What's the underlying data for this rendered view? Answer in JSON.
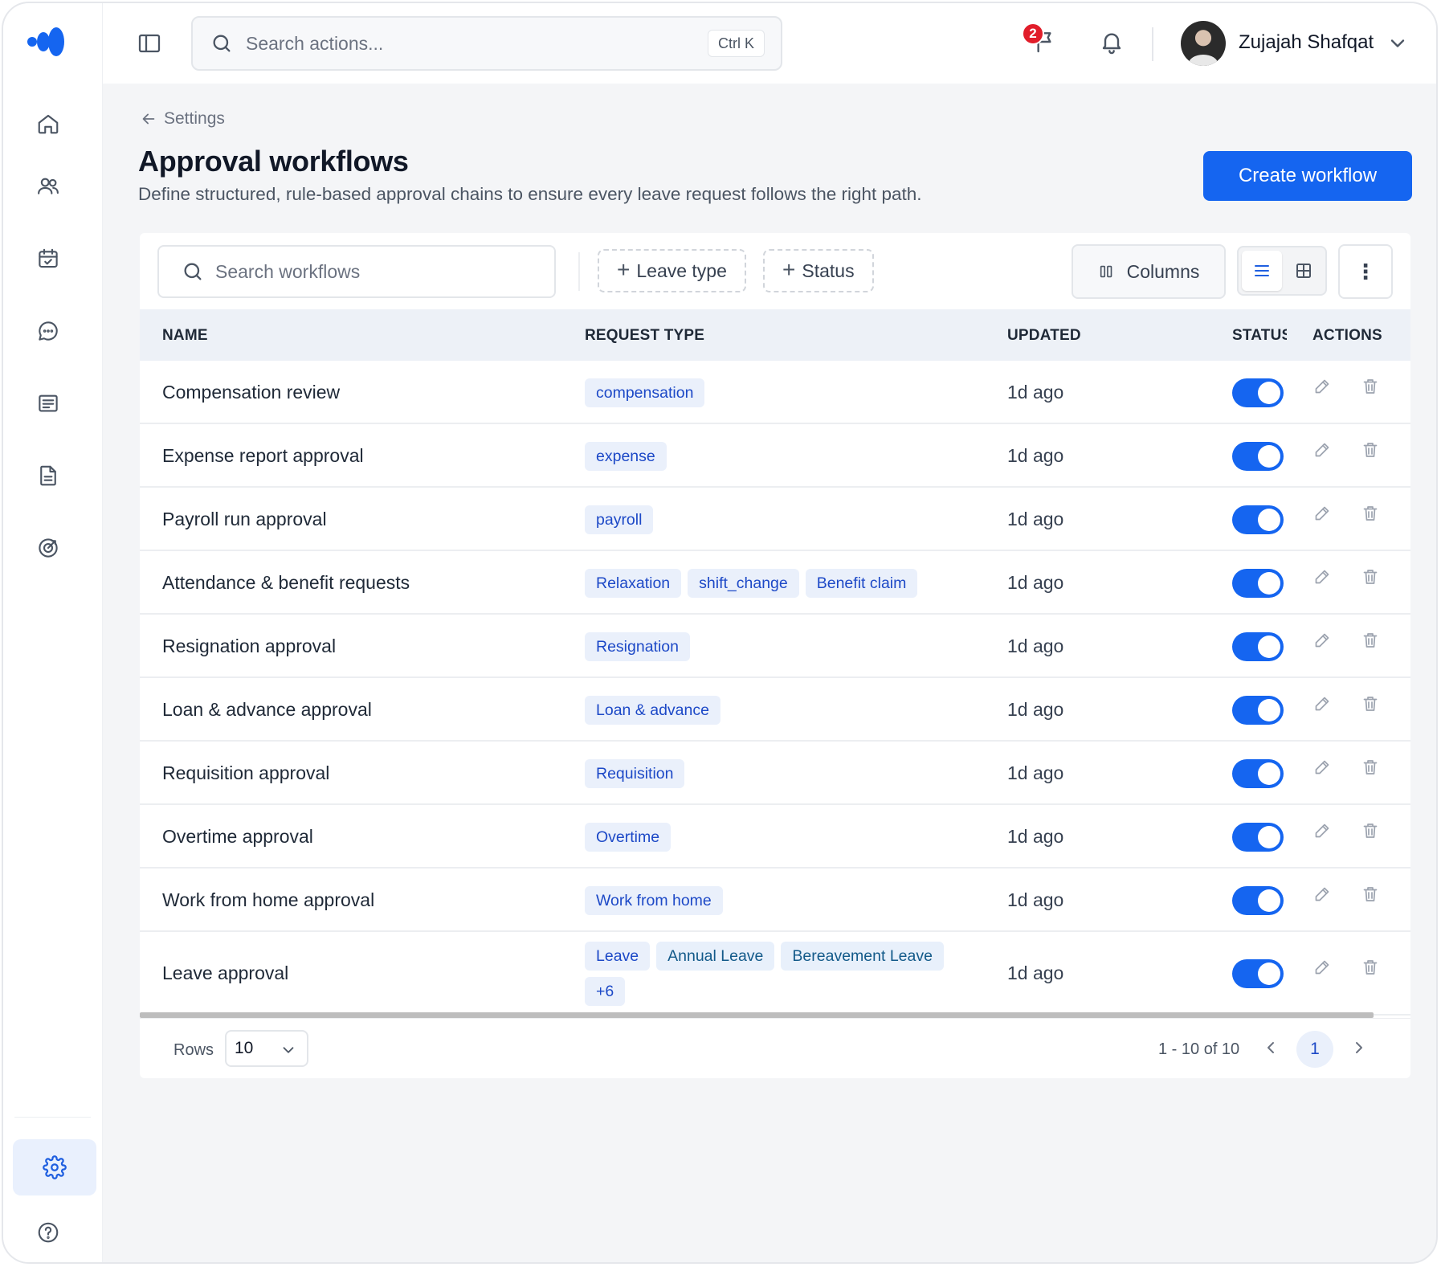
{
  "header": {
    "search_placeholder": "Search actions...",
    "search_shortcut": "Ctrl K",
    "notification_count": "2",
    "user_name": "Zujajah Shafqat"
  },
  "sidebar": {
    "items": [
      {
        "icon": "home-icon"
      },
      {
        "icon": "users-icon"
      },
      {
        "icon": "calendar-check-icon"
      },
      {
        "icon": "chat-icon"
      },
      {
        "icon": "receipt-icon"
      },
      {
        "icon": "document-icon"
      },
      {
        "icon": "target-icon"
      }
    ],
    "bottom": [
      {
        "icon": "settings-icon",
        "active": true
      },
      {
        "icon": "help-icon"
      }
    ]
  },
  "page": {
    "breadcrumb": "Settings",
    "title": "Approval workflows",
    "subtitle": "Define structured, rule-based approval chains to ensure every leave request follows the right path.",
    "create_button": "Create workflow"
  },
  "toolbar": {
    "search_placeholder": "Search workflows",
    "filter_leave_type": "Leave type",
    "filter_status": "Status",
    "columns_label": "Columns"
  },
  "table": {
    "columns": [
      "NAME",
      "REQUEST TYPE",
      "UPDATED",
      "STATUS",
      "ACTIONS"
    ],
    "rows": [
      {
        "name": "Compensation review",
        "tags": [
          "compensation"
        ],
        "updated": "1d ago",
        "enabled": true
      },
      {
        "name": "Expense report approval",
        "tags": [
          "expense"
        ],
        "updated": "1d ago",
        "enabled": true
      },
      {
        "name": "Payroll run approval",
        "tags": [
          "payroll"
        ],
        "updated": "1d ago",
        "enabled": true
      },
      {
        "name": "Attendance & benefit requests",
        "tags": [
          "Relaxation",
          "shift_change",
          "Benefit claim"
        ],
        "updated": "1d ago",
        "enabled": true
      },
      {
        "name": "Resignation approval",
        "tags": [
          "Resignation"
        ],
        "updated": "1d ago",
        "enabled": true
      },
      {
        "name": "Loan & advance approval",
        "tags": [
          "Loan & advance"
        ],
        "updated": "1d ago",
        "enabled": true
      },
      {
        "name": "Requisition approval",
        "tags": [
          "Requisition"
        ],
        "updated": "1d ago",
        "enabled": true
      },
      {
        "name": "Overtime approval",
        "tags": [
          "Overtime"
        ],
        "updated": "1d ago",
        "enabled": true
      },
      {
        "name": "Work from home approval",
        "tags": [
          "Work from home"
        ],
        "updated": "1d ago",
        "enabled": true
      },
      {
        "name": "Leave approval",
        "tags": [
          "Leave",
          "Annual Leave",
          "Bereavement Leave",
          "+6"
        ],
        "updated": "1d ago",
        "enabled": true
      }
    ]
  },
  "footer": {
    "rows_label": "Rows",
    "rows_value": "10",
    "page_info": "1 - 10 of 10",
    "current_page": "1"
  },
  "colors": {
    "accent": "#1565f0",
    "tag_bg": "#eaf0fb",
    "tag_text": "#1d49c7",
    "badge": "#e11d2a"
  }
}
